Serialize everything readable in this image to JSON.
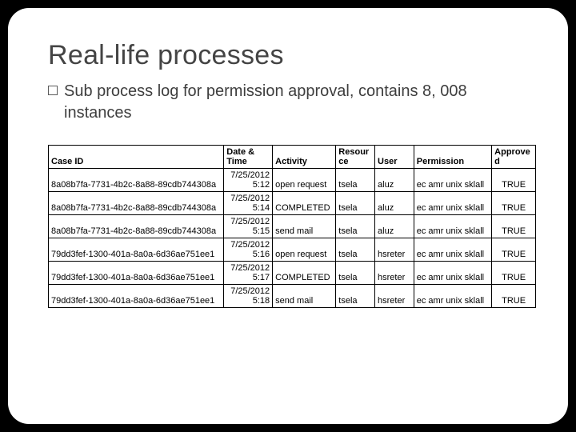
{
  "title": "Real-life processes",
  "subtitle": "Sub process log for permission approval, contains 8, 008 instances",
  "headers": {
    "case_id": "Case ID",
    "date_time": "Date & Time",
    "activity": "Activity",
    "resource": "Resource",
    "user": "User",
    "permission": "Permission",
    "approved": "Approved"
  },
  "rows": [
    {
      "case_id": "8a08b7fa-7731-4b2c-8a88-89cdb744308a",
      "date1": "7/25/2012",
      "date2": "5:12",
      "activity": "open request",
      "resource": "tsela",
      "user": "aluz",
      "permission": "ec amr unix sklall",
      "approved": "TRUE"
    },
    {
      "case_id": "8a08b7fa-7731-4b2c-8a88-89cdb744308a",
      "date1": "7/25/2012",
      "date2": "5:14",
      "activity": "COMPLETED",
      "resource": "tsela",
      "user": "aluz",
      "permission": "ec amr unix sklall",
      "approved": "TRUE"
    },
    {
      "case_id": "8a08b7fa-7731-4b2c-8a88-89cdb744308a",
      "date1": "7/25/2012",
      "date2": "5:15",
      "activity": "send mail",
      "resource": "tsela",
      "user": "aluz",
      "permission": "ec amr unix sklall",
      "approved": "TRUE"
    },
    {
      "case_id": "79dd3fef-1300-401a-8a0a-6d36ae751ee1",
      "date1": "7/25/2012",
      "date2": "5:16",
      "activity": "open request",
      "resource": "tsela",
      "user": "hsreter",
      "permission": "ec amr unix sklall",
      "approved": "TRUE"
    },
    {
      "case_id": "79dd3fef-1300-401a-8a0a-6d36ae751ee1",
      "date1": "7/25/2012",
      "date2": "5:17",
      "activity": "COMPLETED",
      "resource": "tsela",
      "user": "hsreter",
      "permission": "ec amr unix sklall",
      "approved": "TRUE"
    },
    {
      "case_id": "79dd3fef-1300-401a-8a0a-6d36ae751ee1",
      "date1": "7/25/2012",
      "date2": "5:18",
      "activity": "send mail",
      "resource": "tsela",
      "user": "hsreter",
      "permission": "ec amr unix sklall",
      "approved": "TRUE"
    }
  ]
}
